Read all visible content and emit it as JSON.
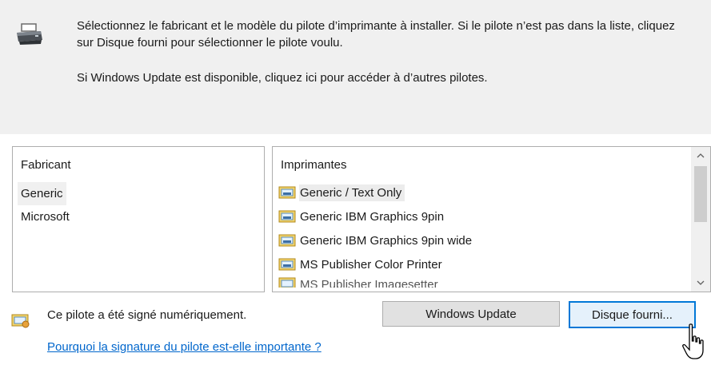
{
  "intro": {
    "line1": "Sélectionnez le fabricant et le modèle du pilote d’imprimante à installer. Si le pilote n’est pas dans la liste, cliquez sur Disque fourni pour sélectionner le pilote voulu.",
    "line2": "Si Windows Update est disponible, cliquez ici pour accéder à d’autres pilotes."
  },
  "manufacturer": {
    "header": "Fabricant",
    "items": [
      "Generic",
      "Microsoft"
    ],
    "selected": "Generic"
  },
  "printers": {
    "header": "Imprimantes",
    "items": [
      "Generic / Text Only",
      "Generic IBM Graphics 9pin",
      "Generic IBM Graphics 9pin wide",
      "MS Publisher Color Printer",
      "MS Publisher Imagesetter"
    ],
    "selected": "Generic / Text Only"
  },
  "footer": {
    "signed_text": "Ce pilote a été signé numériquement.",
    "signature_link": "Pourquoi la signature du pilote est-elle importante ?",
    "windows_update_button": "Windows Update",
    "have_disk_button": "Disque fourni..."
  },
  "icons": {
    "header": "printer-icon",
    "printer_item": "printer-driver-icon",
    "signed": "signed-driver-icon",
    "cursor": "mouse-pointer-icon"
  },
  "colors": {
    "panel_bg": "#f0f0f0",
    "link": "#0066cc",
    "accent_border": "#0078d7",
    "button_hover_bg": "#e5f1fb"
  }
}
